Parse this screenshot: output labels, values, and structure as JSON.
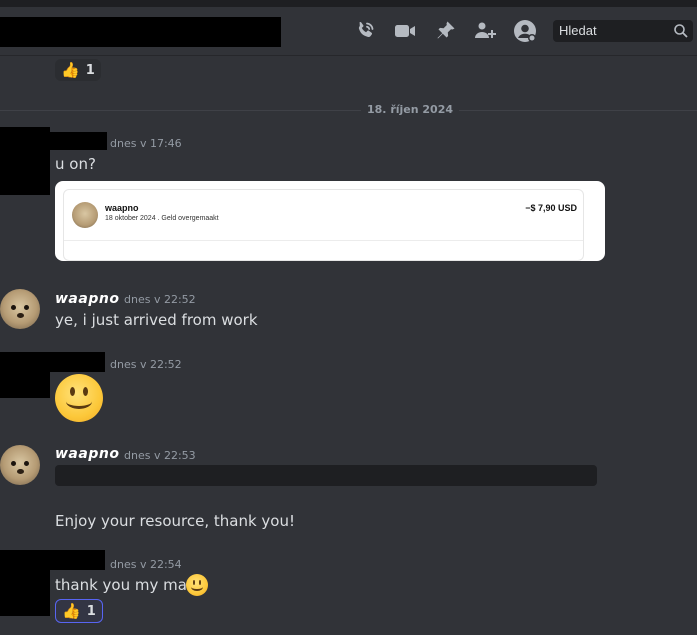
{
  "header": {
    "search_placeholder": "Hledat",
    "icons": [
      "phone-call-icon",
      "video-camera-icon",
      "pin-icon",
      "add-member-icon",
      "profile-icon",
      "search-icon"
    ]
  },
  "top_reaction": {
    "emoji": "👍",
    "count": "1"
  },
  "date_divider": "18. říjen 2024",
  "messages": [
    {
      "author": "",
      "timestamp": "dnes v 17:46",
      "text": "u on?"
    },
    {
      "author": "waapno",
      "timestamp": "dnes v 22:52",
      "text": "ye, i just arrived from work"
    },
    {
      "author": "",
      "timestamp": "dnes v 22:52",
      "emoji": "🙂"
    },
    {
      "author": "waapno",
      "timestamp": "dnes v 22:53",
      "text": "Enjoy your resource, thank you!"
    },
    {
      "author": "",
      "timestamp": "dnes v 22:54",
      "text": "thank you my man!",
      "reaction": {
        "emoji": "👍",
        "count": "1"
      }
    }
  ],
  "embed": {
    "name": "waapno",
    "subtitle": "18 oktober 2024 . Geld overgemaakt",
    "amount": "−$ 7,90 USD"
  },
  "colors": {
    "background": "#313338",
    "accent": "#5865f2",
    "muted": "#949ba4"
  }
}
